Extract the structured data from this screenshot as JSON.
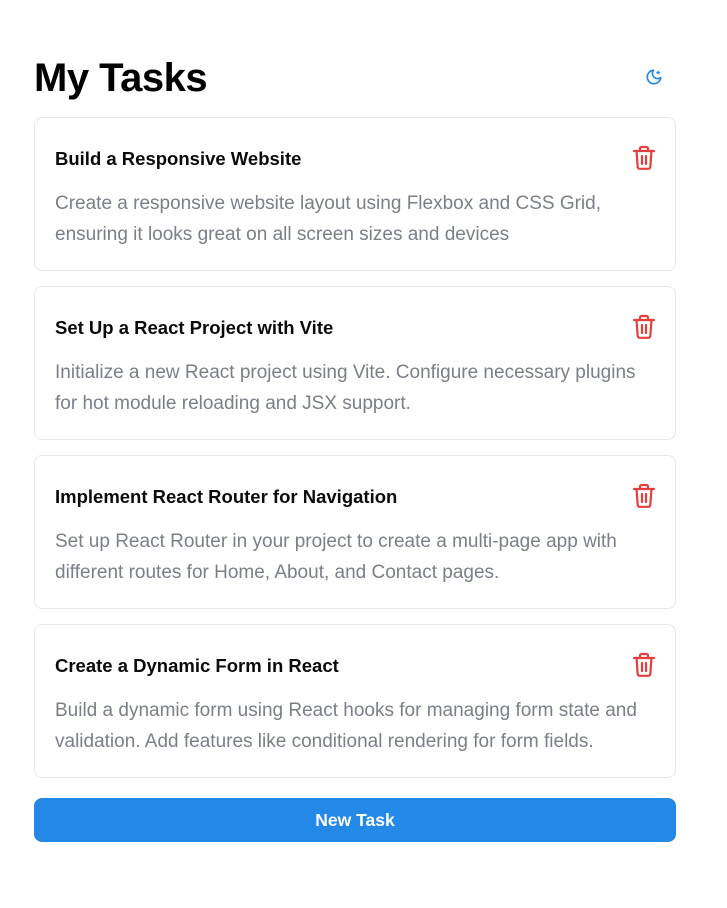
{
  "header": {
    "title": "My Tasks",
    "theme_toggle_icon": "moon-icon"
  },
  "tasks": [
    {
      "title": "Build a Responsive Website",
      "description": "Create a responsive website layout using Flexbox and CSS Grid, ensuring it looks great on all screen sizes and devices",
      "delete_icon": "trash-icon"
    },
    {
      "title": "Set Up a React Project with Vite",
      "description": "Initialize a new React project using Vite. Configure necessary plugins for hot module reloading and JSX support.",
      "delete_icon": "trash-icon"
    },
    {
      "title": "Implement React Router for Navigation",
      "description": "Set up React Router in your project to create a multi-page app with different routes for Home, About, and Contact pages.",
      "delete_icon": "trash-icon"
    },
    {
      "title": "Create a Dynamic Form in React",
      "description": "Build a dynamic form using React hooks for managing form state and validation. Add features like conditional rendering for form fields.",
      "delete_icon": "trash-icon"
    }
  ],
  "new_task_label": "New Task",
  "colors": {
    "accent": "#2488e6",
    "danger": "#e53e3e",
    "muted_text": "#7a7f88",
    "card_border": "#e5e7eb"
  }
}
